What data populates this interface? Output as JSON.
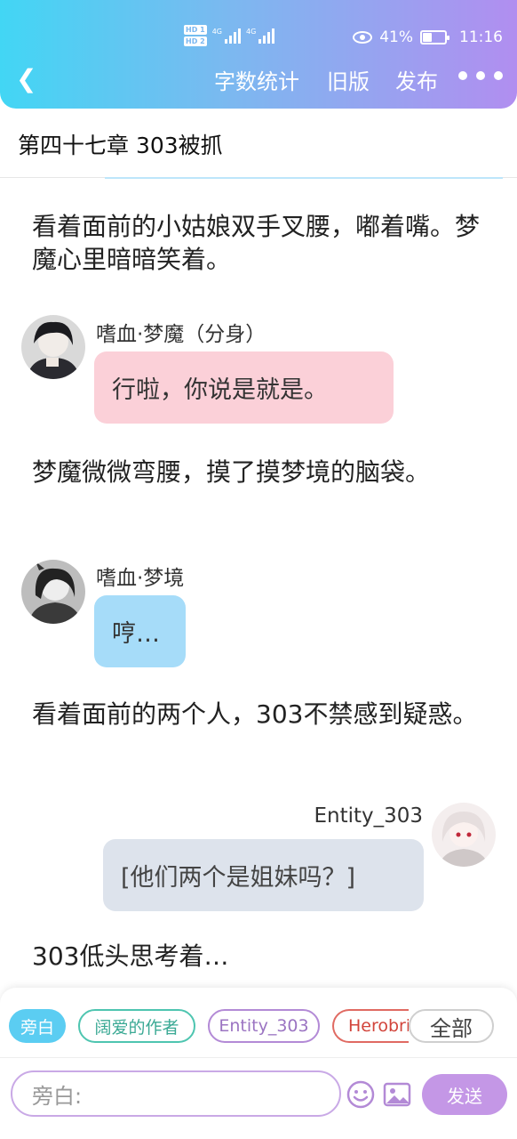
{
  "status_bar": {
    "sim1": "HD 1",
    "sim2": "HD 2",
    "net1": "4G",
    "net2": "4G",
    "battery": "41%",
    "battery_level": 0.41,
    "time": "11:16"
  },
  "nav": {
    "actions": [
      "字数统计",
      "旧版",
      "发布"
    ]
  },
  "chapter_title": "第四十七章 303被抓",
  "story": [
    {
      "type": "narration",
      "text": "看着面前的小姑娘双手叉腰，嘟着嘴。梦魔心里暗暗笑着。"
    },
    {
      "type": "dialogue",
      "speaker": "嗜血·梦魔（分身）",
      "text": "行啦，你说是就是。",
      "bubble_color": "#fbd0d8"
    },
    {
      "type": "narration",
      "text": "梦魔微微弯腰，摸了摸梦境的脑袋。"
    },
    {
      "type": "dialogue",
      "speaker": "嗜血·梦境",
      "text": "哼…",
      "bubble_color": "#a6dcf9"
    },
    {
      "type": "narration",
      "text": "看着面前的两个人，303不禁感到疑惑。"
    },
    {
      "type": "dialogue",
      "speaker": "Entity_303",
      "text": "[他们两个是姐妹吗？]",
      "bubble_color": "#dde3ec"
    },
    {
      "type": "narration",
      "text": "303低头思考着…"
    }
  ],
  "role_chips": {
    "active": "旁白",
    "items": [
      "阔爱的作者",
      "Entity_303",
      "Herobri"
    ],
    "all": "全部"
  },
  "composer": {
    "placeholder": "旁白:",
    "send_label": "发送"
  },
  "colors": {
    "gradient_start": "#42d6f4",
    "gradient_end": "#b18ef0",
    "send_button": "#c497e6"
  }
}
